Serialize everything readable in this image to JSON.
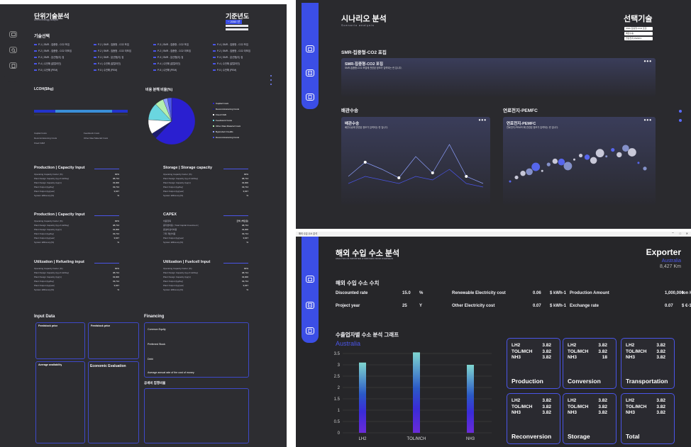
{
  "window1": {
    "title": "단위기술분석",
    "subtitle": "Unit technology analysis",
    "year_label": "기준년도",
    "year_value": "~ 2050 년",
    "tech_section": "기술선택",
    "tech_items": [
      "P-1 | SMR - 집중형 - CO2 포집",
      "P-2 | SMR - 집중형 - CO2 포집",
      "P-3 | SMR - 집중형 - CO2 포집",
      "P-4 | SMR - 집중형 - CO2 포집",
      "P-2 | SMR - 집중형 - CO2 미포집",
      "P-2 | SMR - 집중형 - CO2 미포집",
      "P-2 | SMR - 집중형 - CO2 미포집",
      "P-2 | SMR - 집중형 - CO2 미포집",
      "P-3 | SMR - 분산형(이) 집",
      "P-3 | SMR - 분산형(이) 집",
      "P-3 | SMR - 분산형(이) 집",
      "P-3 | SMR - 분산형(이) 집",
      "P-4 | 수전해 (알칼라인)",
      "P-4 | 수전해 (알칼라인)",
      "P-4 | 수전해 (알칼라인)",
      "P-4 | 수전해 (알칼라인)",
      "P-5 | 수전해 (PEM)",
      "P-5 | 수전해 (PEM)",
      "P-5 | 수전해 (PEM)",
      "P-5 | 수전해 (PEM)"
    ],
    "lcoh_title": "LCOH($/kg)",
    "pie_title": "비용 분해 비율(%)",
    "pie_legend": [
      "Capital Costs",
      "Decommissioning Costs",
      "Fixed O&M",
      "Feedstock Costs",
      "Other Raw Material Costs",
      "Byproduct Credits",
      "Decommissioning Costs"
    ],
    "bar_legend": [
      "Capital Costs",
      "Feedstock Costs",
      "Decommissioning Costs",
      "Other Raw Material Costs",
      "Fixed O&M"
    ],
    "sections": [
      {
        "title": "Production | Capacity Input",
        "rows": [
          [
            "Operating Capacity Factor (%)",
            "90%"
          ],
          [
            "Plant Design Capacity (kg of H2/day)",
            "48,714"
          ],
          [
            "Plant Design Capacity (kg/yr)",
            "43,000"
          ],
          [
            "Plant Output (kg/day)",
            "43,714"
          ],
          [
            "Plant Output (kg/year)",
            "3,647"
          ],
          [
            "System Efficiency(%)",
            "%"
          ]
        ]
      },
      {
        "title": "Storage | Storage capacity",
        "rows": [
          [
            "Operating Capacity Factor (%)",
            "90%"
          ],
          [
            "Plant Design Capacity (kg of H2/day)",
            "48,714"
          ],
          [
            "Plant Design Capacity (kg/yr)",
            "43,000"
          ],
          [
            "Plant Output (kg/day)",
            "43,714"
          ],
          [
            "Plant Output (kg/year)",
            "3,647"
          ],
          [
            "System Efficiency(%)",
            "%"
          ]
        ]
      },
      {
        "title": "Production | Capacity Input",
        "rows": [
          [
            "Operating Capacity Factor (%)",
            "90%"
          ],
          [
            "Plant Design Capacity (kg of H2/day)",
            "48,714"
          ],
          [
            "Plant Design Capacity (kg/yr)",
            "43,000"
          ],
          [
            "Plant Output (kg/day)",
            "43,714"
          ],
          [
            "Plant Output (kg/year)",
            "3,647"
          ],
          [
            "System Efficiency(%)",
            "%"
          ]
        ]
      },
      {
        "title": "CAPEX",
        "rows": [
          [
            "비용항목",
            "금액 (백만원)"
          ],
          [
            "총자본비용 ( Total Capital Investment )",
            "48,714"
          ],
          [
            "총설비설치비용",
            "43,000"
          ],
          [
            "기타 제반비용",
            "43,714"
          ],
          [
            "Plant Output (kg/year)",
            "3,647"
          ],
          [
            "System Efficiency(%)",
            "%"
          ]
        ]
      },
      {
        "title": "Utilization | Refueling input",
        "rows": [
          [
            "Operating Capacity Factor (%)",
            "90%"
          ],
          [
            "Plant Design Capacity (kg of H2/day)",
            "48,714"
          ],
          [
            "Plant Design Capacity (kg/yr)",
            "43,000"
          ],
          [
            "Plant Output (kg/day)",
            "43,714"
          ],
          [
            "Plant Output (kg/year)",
            "3,647"
          ],
          [
            "System Efficiency(%)",
            "%"
          ]
        ]
      },
      {
        "title": "Utilization | Fuelcell Input",
        "rows": [
          [
            "Operating Capacity Factor (%)",
            "90%"
          ],
          [
            "Plant Design Capacity (kg of H2/day)",
            "48,714"
          ],
          [
            "Plant Design Capacity (kg/yr)",
            "43,000"
          ],
          [
            "Plant Output (kg/day)",
            "43,714"
          ],
          [
            "Plant Output (kg/year)",
            "3,647"
          ],
          [
            "System Efficiency(%)",
            "%"
          ]
        ]
      }
    ],
    "input_data": "Input Data",
    "feedstock_price": "Feedstock price",
    "avg_availability": "Average availability",
    "economic_eval": "Economic Evaluation",
    "financing": "Financing",
    "fin_rows": [
      "Common Equity",
      "Preferred Stock",
      "Debt"
    ],
    "fin_note": "Average annual rate of the cost of money",
    "tax": "공세비 집행비율"
  },
  "window2": {
    "title": "시나리오 분석",
    "subtitle": "Scenario analysis",
    "select_label": "선택기술",
    "dropdowns": [
      "SMR-집중형-CO2 포집",
      "배관수송",
      "연료전지-PEMFC"
    ],
    "card1_section": "SMR-집중형-CO2 포집",
    "card1_title": "SMR-집중형-CO2 포집",
    "card1_desc": "SMR-집중형-CO2 포집에 관련된 정보가 입력되는 란 입니다.",
    "card2_section": "배관수송",
    "card2_title": "배관수송",
    "card2_desc": "배관수송에 관련된 정보가 입력되는 란 입니다.",
    "card3_section": "연료전지-PEMFC",
    "card3_title": "연료전지-PEMFC",
    "card3_desc": "연료전지-PEMFC에 관련된 정보가 입력되는 란 입니다.",
    "more": "•••"
  },
  "window3": {
    "titlebar": "해외 수입 수소 분석",
    "title": "해외 수입 수소 분석",
    "subtitle": "ANALYSIS OF IMPORTED HYDROGEN FROM OVERSEAS",
    "exporter_label": "Exporter",
    "exporter_country": "Australia",
    "exporter_distance": "8,427 Km",
    "values_section": "해외 수입 수소 수치",
    "kv": [
      {
        "k": "Discounted rate",
        "v": "15.0",
        "u": "%"
      },
      {
        "k": "Renewable Electricity cost",
        "v": "0.06",
        "u": "$ kWh-1"
      },
      {
        "k": "Production Amount",
        "v": "1,000,000",
        "u": "ton H2 y-1"
      },
      {
        "k": "Project year",
        "v": "25",
        "u": "Y"
      },
      {
        "k": "Other Electricity cost",
        "v": "0.07",
        "u": "$ kWh-1"
      },
      {
        "k": "Exchange rate",
        "v": "0.07",
        "u": "$ €-1"
      }
    ],
    "chart_section": "수출업자별 수소 분석 그래프",
    "chart_sub": "Australia",
    "cards": [
      {
        "title": "Production",
        "lines": [
          [
            "LH2",
            "3.82"
          ],
          [
            "TOL/MCH",
            "3.82"
          ],
          [
            "NH3",
            "3.82"
          ]
        ]
      },
      {
        "title": "Conversion",
        "lines": [
          [
            "LH2",
            "3.82"
          ],
          [
            "TOL/MCH",
            "3.82"
          ],
          [
            "NH3",
            "18"
          ]
        ]
      },
      {
        "title": "Transportation",
        "lines": [
          [
            "LH2",
            "3.82"
          ],
          [
            "TOL/MCH",
            "3.82"
          ],
          [
            "NH3",
            "3.82"
          ]
        ]
      },
      {
        "title": "Reconversion",
        "lines": [
          [
            "LH2",
            "3.82"
          ],
          [
            "TOL/MCH",
            "3.82"
          ],
          [
            "NH3",
            "3.82"
          ]
        ]
      },
      {
        "title": "Storage",
        "lines": [
          [
            "LH2",
            "3.82"
          ],
          [
            "TOL/MCH",
            "3.82"
          ],
          [
            "NH3",
            "3.82"
          ]
        ]
      },
      {
        "title": "Total",
        "lines": [
          [
            "LH2",
            "3.82"
          ],
          [
            "TOL/MCH",
            "3.82"
          ],
          [
            "NH3",
            "3.82"
          ]
        ]
      }
    ]
  },
  "chart_data": [
    {
      "type": "bar",
      "title": "",
      "categories": [
        "LH2",
        "TOL/MCH",
        "NH3"
      ],
      "values": [
        3.1,
        3.55,
        3.0
      ],
      "ylim": [
        0,
        3.5
      ],
      "yticks": [
        0,
        0.5,
        1,
        1.5,
        2,
        2.5,
        3,
        3.5
      ]
    },
    {
      "type": "pie",
      "title": "비용 분해 비율(%)",
      "categories": [
        "Capital Costs",
        "Decommissioning Costs",
        "Fixed O&M",
        "Feedstock Costs",
        "Other Raw Material Costs",
        "Byproduct Credits",
        "Decommissioning Costs"
      ],
      "values": [
        62,
        4,
        10,
        12,
        6,
        3,
        3
      ]
    },
    {
      "type": "line",
      "title": "배관수송",
      "x": [
        1,
        2,
        3,
        4,
        5,
        6,
        7,
        8,
        9
      ],
      "series": [
        {
          "values": [
            3,
            5,
            4,
            2.8,
            5.8,
            3.5,
            7.5,
            3,
            2
          ]
        },
        {
          "values": [
            2,
            3,
            2.5,
            2,
            3,
            2.5,
            4,
            2,
            1.5
          ]
        }
      ]
    },
    {
      "type": "scatter",
      "title": "연료전지-PEMFC",
      "x": [
        1,
        2,
        3,
        4,
        5,
        6,
        7,
        8,
        9,
        10,
        11,
        12,
        13,
        14,
        15,
        16,
        17,
        18,
        19,
        20,
        21,
        22
      ],
      "values": [
        2,
        2.5,
        3,
        3.2,
        3.8,
        3.3,
        4.1,
        4.5,
        4.4,
        3.9,
        4.7,
        5.2,
        5.0,
        4.6,
        5.5,
        5.1,
        5.9,
        5.3,
        6.1,
        5.6,
        4.3,
        3.6
      ]
    }
  ]
}
